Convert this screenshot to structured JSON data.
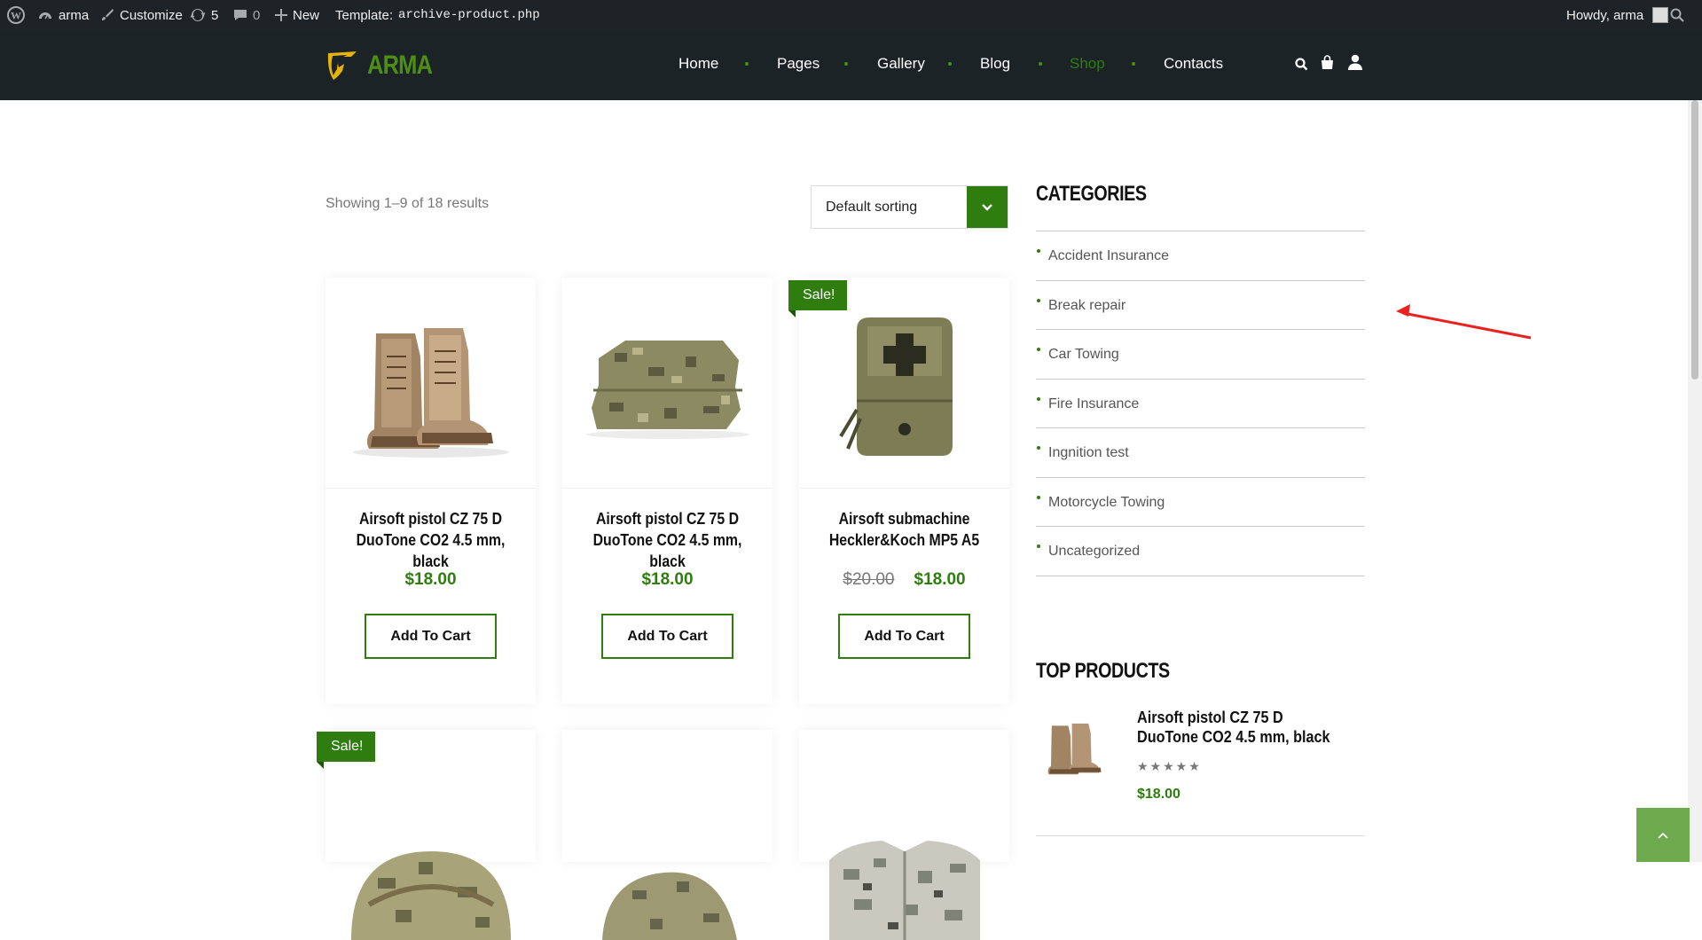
{
  "admin_bar": {
    "site_name": "arma",
    "customize": "Customize",
    "updates_count": "5",
    "comments_count": "0",
    "new_label": "New",
    "template_label": "Template:",
    "template_file": "archive-product.php",
    "greeting": "Howdy, arma"
  },
  "header": {
    "logo_text": "ARMA",
    "nav": [
      {
        "label": "Home",
        "active": false
      },
      {
        "label": "Pages",
        "active": false
      },
      {
        "label": "Gallery",
        "active": false
      },
      {
        "label": "Blog",
        "active": false
      },
      {
        "label": "Shop",
        "active": true
      },
      {
        "label": "Contacts",
        "active": false
      }
    ],
    "icons": [
      "search-icon",
      "cart-icon",
      "user-icon"
    ]
  },
  "shop": {
    "results_text": "Showing 1–9 of 18 results",
    "sorting_value": "Default sorting",
    "products": [
      {
        "title": "Airsoft pistol CZ 75 D DuoTone CO2 4.5 mm, black",
        "price": "$18.00",
        "old_price": "",
        "sale": "",
        "button": "Add To Cart",
        "image": "boots"
      },
      {
        "title": "Airsoft pistol CZ 75 D DuoTone CO2 4.5 mm, black",
        "price": "$18.00",
        "old_price": "",
        "sale": "",
        "button": "Add To Cart",
        "image": "folded-camo"
      },
      {
        "title": "Airsoft submachine Heckler&Koch MP5 A5",
        "price": "$18.00",
        "old_price": "$20.00",
        "sale": "Sale!",
        "button": "Add To Cart",
        "image": "first-aid-pouch"
      },
      {
        "title": "",
        "price": "",
        "old_price": "",
        "sale": "Sale!",
        "button": "",
        "image": "camo-helmet"
      },
      {
        "title": "",
        "price": "",
        "old_price": "",
        "sale": "",
        "button": "",
        "image": "camo-cap"
      },
      {
        "title": "",
        "price": "",
        "old_price": "",
        "sale": "",
        "button": "",
        "image": "camo-jacket"
      }
    ]
  },
  "sidebar": {
    "categories_title": "CATEGORIES",
    "categories": [
      "Accident Insurance",
      "Break repair",
      "Car Towing",
      "Fire Insurance",
      "Ingnition test",
      "Motorcycle Towing",
      "Uncategorized"
    ],
    "top_products_title": "TOP PRODUCTS",
    "top_product": {
      "name": "Airsoft pistol CZ 75 D DuoTone CO2 4.5 mm, black",
      "rating": 0,
      "price": "$18.00"
    }
  },
  "colors": {
    "accent": "#2e7d0e",
    "header_bg": "#1c2327",
    "admin_bg": "#1d2327",
    "annotation_arrow": "#e8231f"
  }
}
